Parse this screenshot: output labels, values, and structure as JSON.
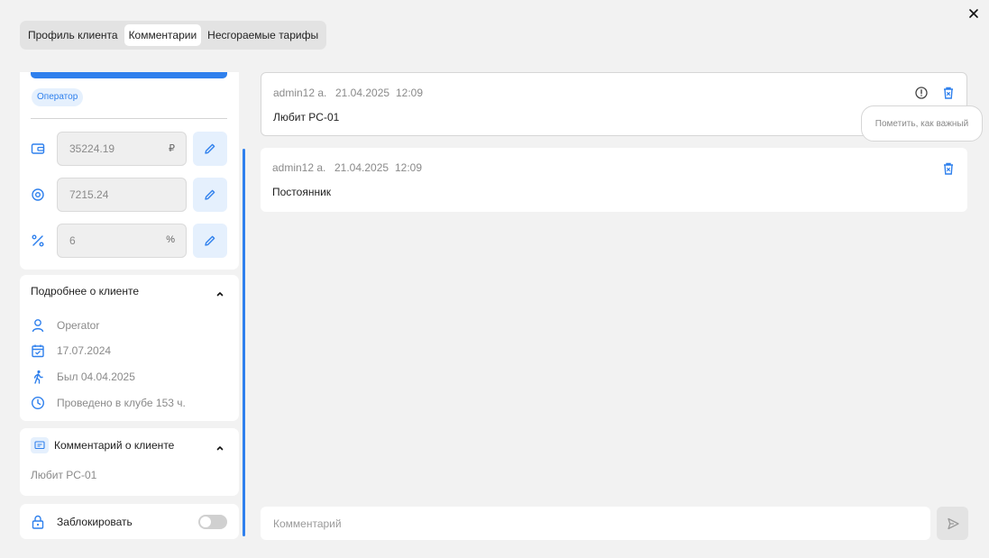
{
  "tabs": [
    {
      "label": "Профиль клиента",
      "active": false
    },
    {
      "label": "Комментарии",
      "active": true
    },
    {
      "label": "Несгораемые тарифы",
      "active": false
    }
  ],
  "profile": {
    "role_badge": "Оператор",
    "balances": [
      {
        "icon": "wallet-icon",
        "value": "35224.19",
        "unit": "₽"
      },
      {
        "icon": "bonus-icon",
        "value": "7215.24",
        "unit": ""
      },
      {
        "icon": "percent-icon",
        "value": "6",
        "unit": "%"
      }
    ]
  },
  "details": {
    "title": "Подробнее о клиенте",
    "items": [
      {
        "icon": "user-icon",
        "text": "Operator"
      },
      {
        "icon": "calendar-icon",
        "text": "17.07.2024"
      },
      {
        "icon": "walking-icon",
        "text": "Был 04.04.2025"
      },
      {
        "icon": "clock-icon",
        "text": "Проведено в клубе 153 ч."
      }
    ]
  },
  "client_comment": {
    "title": "Комментарий о клиенте",
    "text": "Любит PC-01"
  },
  "lock": {
    "label": "Заблокировать",
    "enabled": false
  },
  "comments": [
    {
      "author": "admin12 a.",
      "date": "21.04.2025",
      "time": "12:09",
      "text": "Любит PC-01",
      "show_important": true
    },
    {
      "author": "admin12 a.",
      "date": "21.04.2025",
      "time": "12:09",
      "text": "Постоянник",
      "show_important": false
    }
  ],
  "tooltip": "Пометить, как важный",
  "input": {
    "placeholder": "Комментарий",
    "value": ""
  },
  "colors": {
    "accent": "#2f80ed",
    "accent_light": "#e5f0fd",
    "background": "#f2f2f2"
  }
}
